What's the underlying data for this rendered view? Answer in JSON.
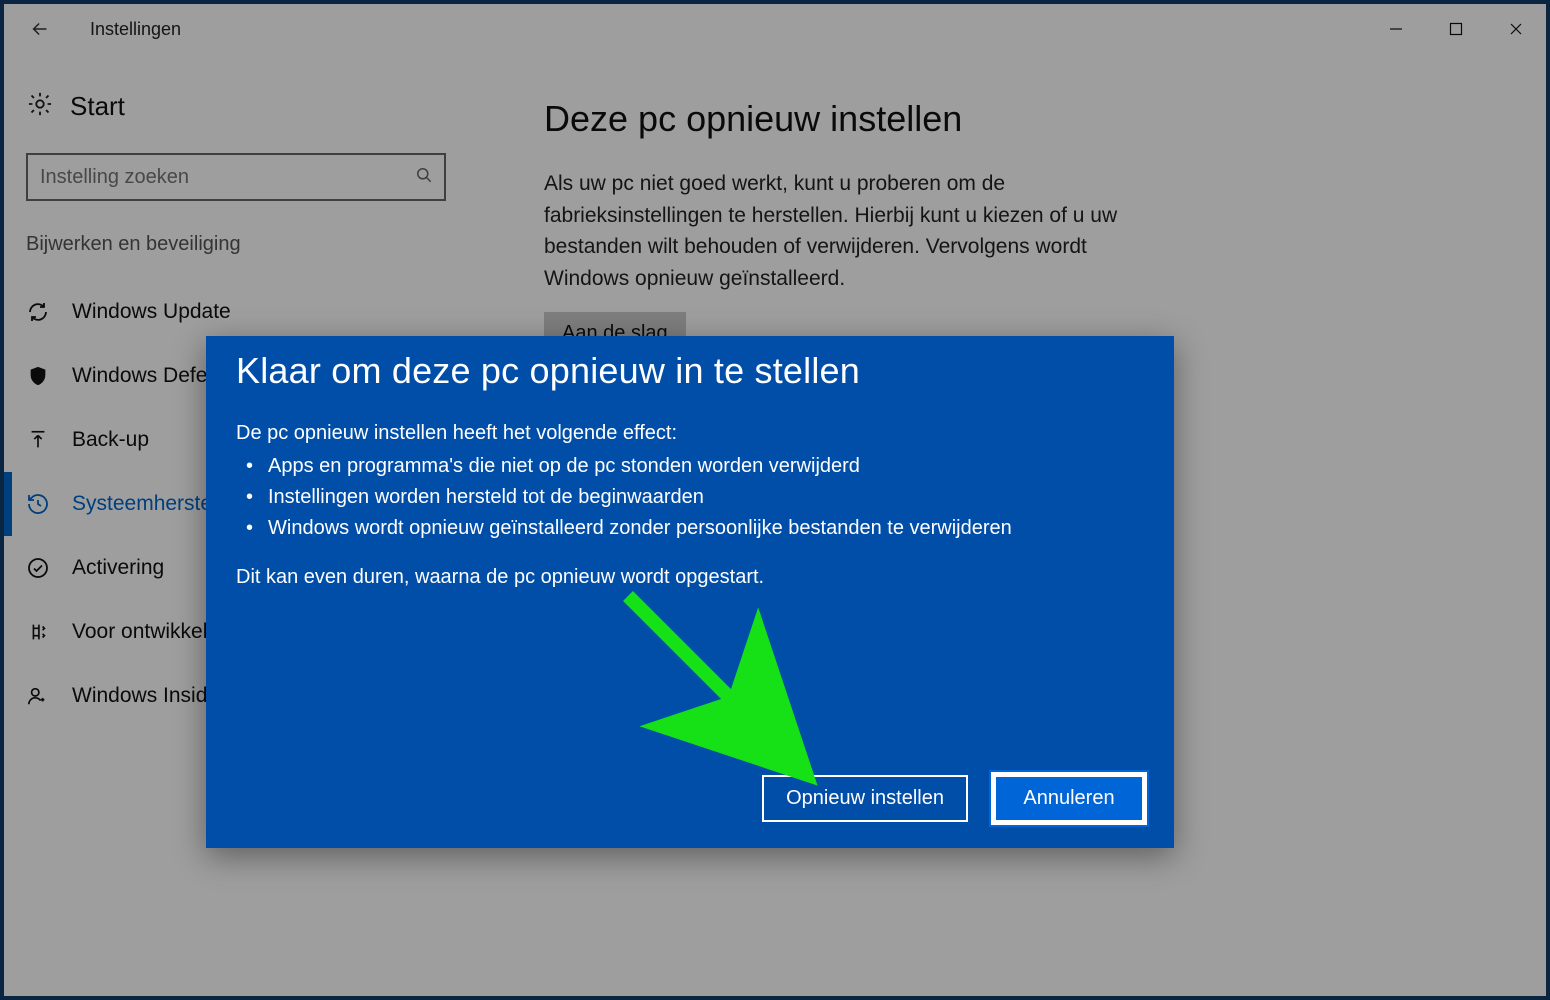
{
  "window": {
    "title": "Instellingen"
  },
  "sidebar": {
    "header": "Start",
    "search_placeholder": "Instelling zoeken",
    "section": "Bijwerken en beveiliging",
    "items": [
      {
        "label": "Windows Update",
        "icon": "refresh"
      },
      {
        "label": "Windows Defender",
        "icon": "shield"
      },
      {
        "label": "Back-up",
        "icon": "backup"
      },
      {
        "label": "Systeemherstel",
        "icon": "history",
        "active": true
      },
      {
        "label": "Activering",
        "icon": "checkcircle"
      },
      {
        "label": "Voor ontwikkelaars",
        "icon": "dev"
      },
      {
        "label": "Windows Insider",
        "icon": "insider"
      }
    ]
  },
  "main": {
    "title": "Deze pc opnieuw instellen",
    "description": "Als uw pc niet goed werkt, kunt u proberen om de fabrieksinstellingen te herstellen. Hierbij kunt u kiezen of u uw bestanden wilt behouden of verwijderen. Vervolgens wordt Windows opnieuw geïnstalleerd.",
    "button": "Aan de slag"
  },
  "dialog": {
    "title": "Klaar om deze pc opnieuw in te stellen",
    "intro": "De pc opnieuw instellen heeft het volgende effect:",
    "bullets": [
      "Apps en programma's die niet op de pc stonden worden verwijderd",
      "Instellingen worden hersteld tot de beginwaarden",
      "Windows wordt opnieuw geïnstalleerd zonder persoonlijke bestanden te verwijderen"
    ],
    "note": "Dit kan even duren, waarna de pc opnieuw wordt opgestart.",
    "primary_button": "Opnieuw instellen",
    "secondary_button": "Annuleren"
  }
}
